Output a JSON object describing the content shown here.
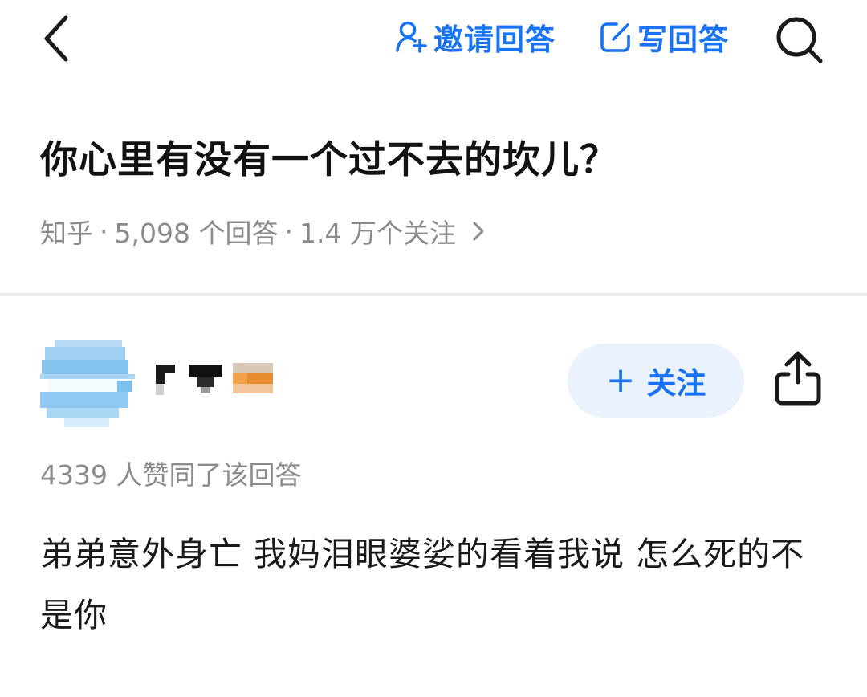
{
  "nav": {
    "back_icon": "chevron-left-icon",
    "invite_icon": "user-plus-icon",
    "invite_label": "邀请回答",
    "write_icon": "edit-icon",
    "write_label": "写回答",
    "search_icon": "search-icon"
  },
  "question": {
    "title": "你心里有没有一个过不去的坎儿？",
    "source": "知乎",
    "separator": "·",
    "answer_count": "5,098 个回答",
    "follower_count": "1.4 万个关注"
  },
  "answer": {
    "author_name": "",
    "follow_label": "关注",
    "follow_icon": "plus-icon",
    "share_icon": "share-icon",
    "vote_text": "4339 人赞同了该回答",
    "content": "弟弟意外身亡 我妈泪眼婆娑的看着我说 怎么死的不是你"
  },
  "colors": {
    "brand_blue": "#1772f6",
    "follow_bg": "#eaf2fd",
    "meta_gray": "#8a8a8f",
    "divider": "#ececee"
  }
}
